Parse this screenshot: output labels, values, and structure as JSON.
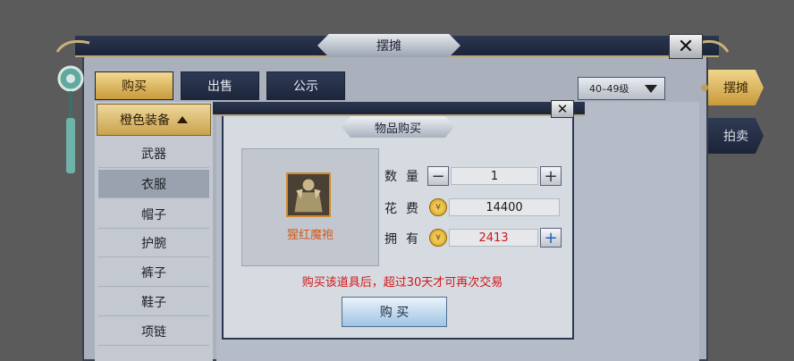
{
  "window": {
    "title": "摆摊",
    "close_glyph": "✕"
  },
  "tabs": [
    {
      "label": "购买"
    },
    {
      "label": "出售"
    },
    {
      "label": "公示"
    }
  ],
  "level_filter": {
    "value": "40–49级"
  },
  "side_tabs": [
    {
      "label": "摆摊"
    },
    {
      "label": "拍卖"
    }
  ],
  "categories": {
    "header": "橙色装备",
    "items": [
      {
        "label": "武器"
      },
      {
        "label": "衣服"
      },
      {
        "label": "帽子"
      },
      {
        "label": "护腕"
      },
      {
        "label": "裤子"
      },
      {
        "label": "鞋子"
      },
      {
        "label": "项链"
      }
    ],
    "selected": "衣服"
  },
  "dialog": {
    "title": "物品购买",
    "close_glyph": "✕",
    "item": {
      "name": "猩红魔袍",
      "icon": "robe-armor-icon"
    },
    "quantity": {
      "label": "数量",
      "value": "1",
      "minus": "−",
      "plus": "+"
    },
    "cost": {
      "label": "花费",
      "value": "14400"
    },
    "owned": {
      "label": "拥有",
      "value": "2413",
      "plus": "+"
    },
    "warning": "购买该道具后，超过30天才可再次交易",
    "buy_button": "购 买"
  },
  "colors": {
    "accent_gold": "#c99b3c",
    "navy": "#1d263b",
    "warning_red": "#d01818",
    "item_orange": "#d35a1c"
  }
}
